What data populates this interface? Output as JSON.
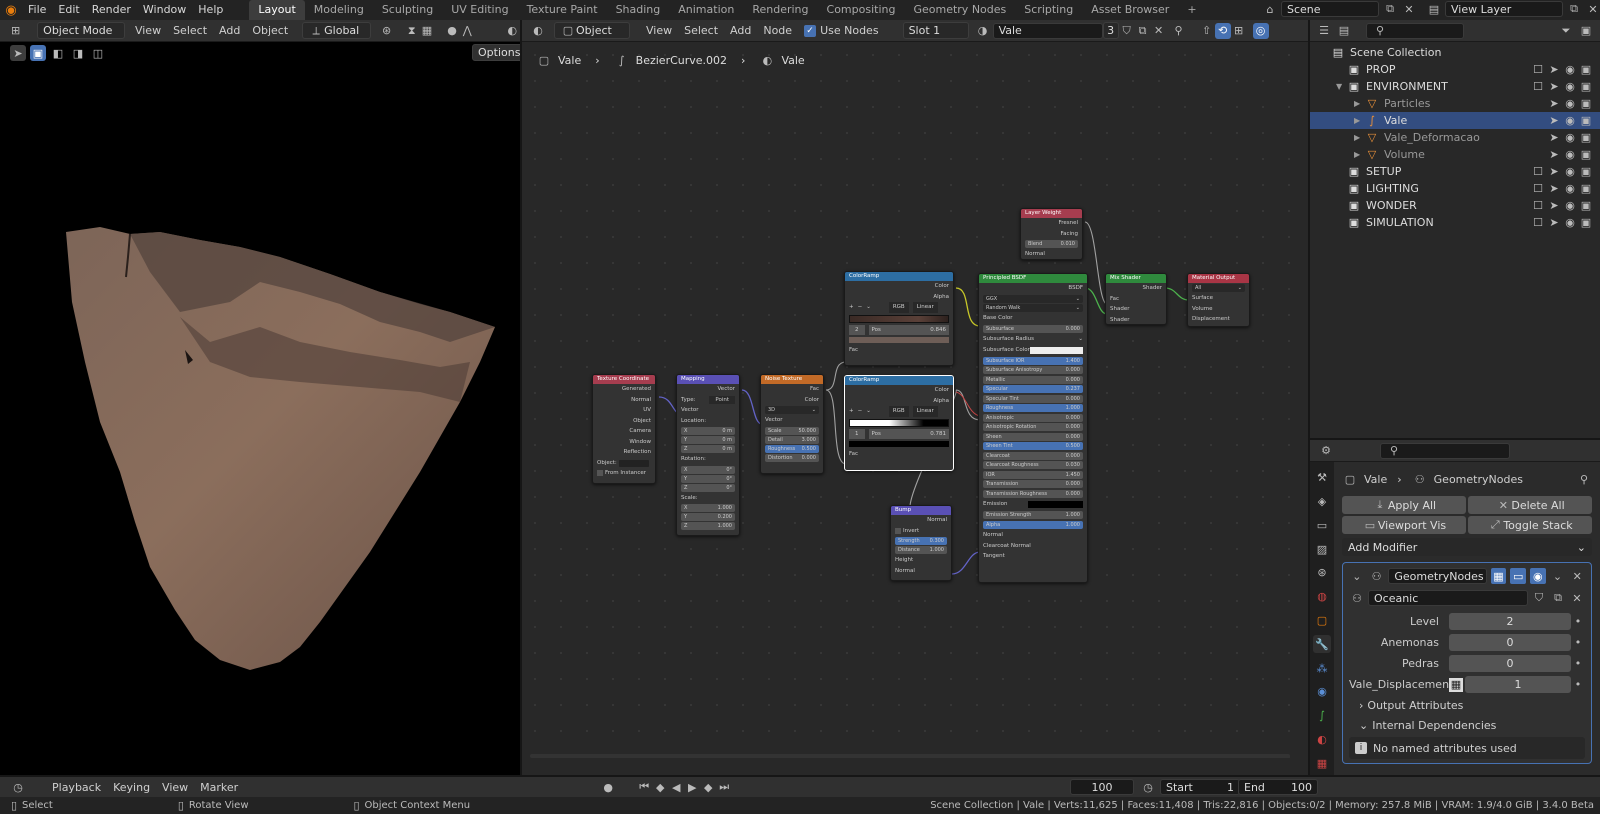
{
  "app": {
    "logo_icon": "blender-logo-icon"
  },
  "menu": [
    "File",
    "Edit",
    "Render",
    "Window",
    "Help"
  ],
  "workspaces": {
    "tabs": [
      "Layout",
      "Modeling",
      "Sculpting",
      "UV Editing",
      "Texture Paint",
      "Shading",
      "Animation",
      "Rendering",
      "Compositing",
      "Geometry Nodes",
      "Scripting",
      "Asset Browser"
    ],
    "active": "Layout",
    "add": "+"
  },
  "scene": {
    "name": "Scene",
    "view_layer": "View Layer"
  },
  "viewport": {
    "mode": "Object Mode",
    "menus": [
      "View",
      "Select",
      "Add",
      "Object"
    ],
    "orientation": "Global",
    "options": "Options"
  },
  "node_editor": {
    "type": "Object",
    "menus": [
      "View",
      "Select",
      "Add",
      "Node"
    ],
    "use_nodes": "Use Nodes",
    "slot": "Slot 1",
    "material": "Vale",
    "users": "3",
    "breadcrumb": [
      "Vale",
      "BezierCurve.002",
      "Vale"
    ]
  },
  "nodes": {
    "texcoord": {
      "title": "Texture Coordinate",
      "outputs": [
        "Generated",
        "Normal",
        "UV",
        "Object",
        "Camera",
        "Window",
        "Reflection"
      ],
      "object_label": "Object:",
      "from_instancer": "From Instancer"
    },
    "mapping": {
      "title": "Mapping",
      "out": "Vector",
      "type_label": "Type:",
      "type": "Point",
      "vector": "Vector",
      "location": "Location:",
      "loc": [
        [
          "X",
          "0 m"
        ],
        [
          "Y",
          "0 m"
        ],
        [
          "Z",
          "0 m"
        ]
      ],
      "rotation": "Rotation:",
      "rot": [
        [
          "X",
          "0°"
        ],
        [
          "Y",
          "0°"
        ],
        [
          "Z",
          "0°"
        ]
      ],
      "scale": "Scale:",
      "scl": [
        [
          "X",
          "1.000"
        ],
        [
          "Y",
          "0.200"
        ],
        [
          "Z",
          "1.000"
        ]
      ]
    },
    "noise": {
      "title": "Noise Texture",
      "outputs": [
        "Fac",
        "Color"
      ],
      "dim": "3D",
      "vector": "Vector",
      "fields": [
        [
          "Scale",
          "50.000"
        ],
        [
          "Detail",
          "3.000"
        ],
        [
          "Roughness",
          "0.500"
        ],
        [
          "Distortion",
          "0.000"
        ]
      ]
    },
    "ramp1": {
      "title": "ColorRamp",
      "outputs": [
        "Color",
        "Alpha"
      ],
      "mode": "RGB",
      "interp": "Linear",
      "index": "2",
      "pos_label": "Pos",
      "pos": "0.846",
      "fac": "Fac"
    },
    "ramp2": {
      "title": "ColorRamp",
      "outputs": [
        "Color",
        "Alpha"
      ],
      "mode": "RGB",
      "interp": "Linear",
      "index": "1",
      "pos_label": "Pos",
      "pos": "0.781",
      "fac": "Fac"
    },
    "layer_weight": {
      "title": "Layer Weight",
      "outputs": [
        "Fresnel",
        "Facing"
      ],
      "blend_label": "Blend",
      "blend": "0.010",
      "normal": "Normal"
    },
    "bsdf": {
      "title": "Principled BSDF",
      "output": "BSDF",
      "dist": "GGX",
      "sss": "Random Walk",
      "base_color": "Base Color",
      "fields": [
        [
          "Subsurface",
          "0.000"
        ],
        [
          "Subsurface Radius",
          ""
        ],
        [
          "Subsurface Color",
          ""
        ],
        [
          "Subsurface IOR",
          "1.400"
        ],
        [
          "Subsurface Anisotropy",
          "0.000"
        ],
        [
          "Metallic",
          "0.000"
        ],
        [
          "Specular",
          "0.237"
        ],
        [
          "Specular Tint",
          "0.000"
        ],
        [
          "Roughness",
          "1.000"
        ],
        [
          "Anisotropic",
          "0.000"
        ],
        [
          "Anisotropic Rotation",
          "0.000"
        ],
        [
          "Sheen",
          "0.000"
        ],
        [
          "Sheen Tint",
          "0.500"
        ],
        [
          "Clearcoat",
          "0.000"
        ],
        [
          "Clearcoat Roughness",
          "0.030"
        ],
        [
          "IOR",
          "1.450"
        ],
        [
          "Transmission",
          "0.000"
        ],
        [
          "Transmission Roughness",
          "0.000"
        ],
        [
          "Emission",
          ""
        ],
        [
          "Emission Strength",
          "1.000"
        ],
        [
          "Alpha",
          "1.000"
        ]
      ],
      "tail": [
        "Normal",
        "Clearcoat Normal",
        "Tangent"
      ]
    },
    "bump": {
      "title": "Bump",
      "output": "Normal",
      "invert": "Invert",
      "fields": [
        [
          "Strength",
          "0.300"
        ],
        [
          "Distance",
          "1.000"
        ]
      ],
      "inputs": [
        "Height",
        "Normal"
      ]
    },
    "mix": {
      "title": "Mix Shader",
      "output": "Shader",
      "inputs": [
        "Fac",
        "Shader",
        "Shader"
      ]
    },
    "matout": {
      "title": "Material Output",
      "target": "All",
      "inputs": [
        "Surface",
        "Volume",
        "Displacement"
      ]
    }
  },
  "outliner": {
    "root": "Scene Collection",
    "items": [
      {
        "label": "PROP",
        "depth": 0,
        "icon": "collection-icon"
      },
      {
        "label": "ENVIRONMENT",
        "depth": 0,
        "icon": "collection-icon",
        "expanded": true
      },
      {
        "label": "Particles",
        "depth": 1,
        "icon": "mesh-icon"
      },
      {
        "label": "Vale",
        "depth": 1,
        "icon": "curve-icon",
        "selected": true
      },
      {
        "label": "Vale_Deformacao",
        "depth": 1,
        "icon": "mesh-icon"
      },
      {
        "label": "Volume",
        "depth": 1,
        "icon": "mesh-icon"
      },
      {
        "label": "SETUP",
        "depth": 0,
        "icon": "collection-icon"
      },
      {
        "label": "LIGHTING",
        "depth": 0,
        "icon": "collection-icon"
      },
      {
        "label": "WONDER",
        "depth": 0,
        "icon": "collection-icon"
      },
      {
        "label": "SIMULATION",
        "depth": 0,
        "icon": "collection-icon"
      }
    ]
  },
  "properties": {
    "breadcrumb": [
      "Vale",
      "GeometryNodes"
    ],
    "apply_all": "Apply All",
    "delete_all": "Delete All",
    "viewport_vis": "Viewport Vis",
    "toggle_stack": "Toggle Stack",
    "add_modifier": "Add Modifier",
    "modifier_name": "GeometryNodes",
    "node_group": "Oceanic",
    "params": [
      [
        "Level",
        "2"
      ],
      [
        "Anemonas",
        "0"
      ],
      [
        "Pedras",
        "0"
      ],
      [
        "Vale_Displacement",
        "1"
      ]
    ],
    "output_attributes": "Output Attributes",
    "internal_deps": "Internal Dependencies",
    "no_attrs": "No named attributes used"
  },
  "timeline": {
    "menus": [
      "Playback",
      "Keying",
      "View",
      "Marker"
    ],
    "frame": "100",
    "start_label": "Start",
    "start": "1",
    "end_label": "End",
    "end": "100"
  },
  "statusbar": {
    "left": [
      "Select",
      "Rotate View",
      "Object Context Menu"
    ],
    "stats": "Scene Collection | Vale | Verts:11,625 | Faces:11,408 | Tris:22,816 | Objects:0/2 | Memory: 257.8 MiB | VRAM: 1.9/4.0 GiB | 3.4.0 Beta"
  },
  "colors": {
    "accent": "#4772b3",
    "selected_row": "#334d80",
    "input_node": "#a63d4f",
    "vector_node": "#5a50b5",
    "texture_node": "#c26a27",
    "converter_node": "#2d6ea3",
    "shader_node": "#2f8a3d",
    "output_node": "#a83545"
  }
}
